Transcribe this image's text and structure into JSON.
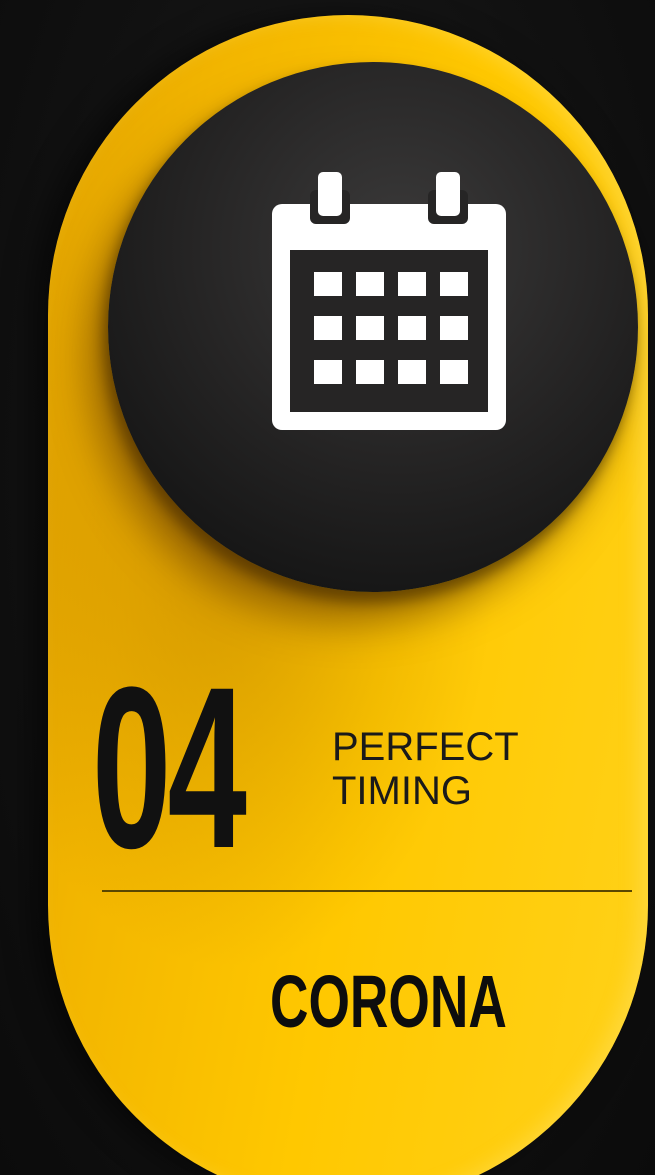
{
  "step": {
    "number": "04",
    "title_line1": "PERFECT",
    "title_line2": "TIMING",
    "brand": "CORONA"
  },
  "icon": "calendar-icon",
  "colors": {
    "pill": "#ffc800",
    "circle": "#262525",
    "icon": "#ffffff",
    "text": "#111111"
  }
}
